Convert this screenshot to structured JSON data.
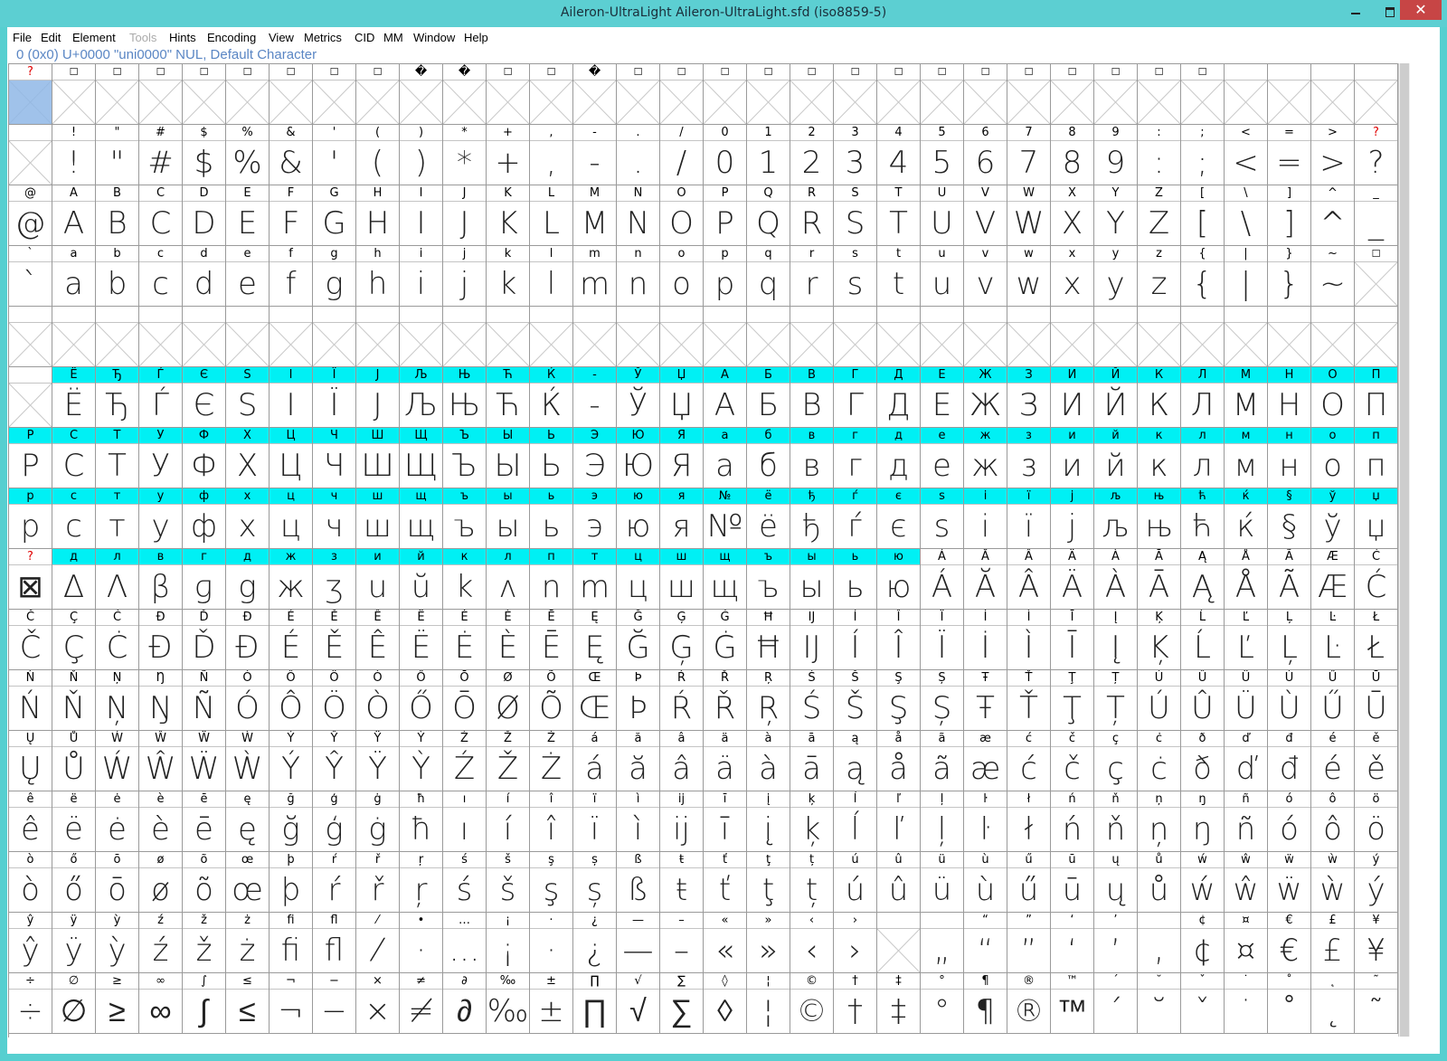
{
  "window": {
    "title": "Aileron-UltraLight  Aileron-UltraLight.sfd (iso8859-5)",
    "close_label": "✕"
  },
  "menu": [
    {
      "label": "File",
      "enabled": true
    },
    {
      "label": "Edit",
      "enabled": true
    },
    {
      "label": "Element",
      "enabled": true
    },
    {
      "label": "Tools",
      "enabled": false
    },
    {
      "label": "Hints",
      "enabled": true
    },
    {
      "label": "Encoding",
      "enabled": true
    },
    {
      "label": "View",
      "enabled": true
    },
    {
      "label": "Metrics",
      "enabled": true
    },
    {
      "label": "CID",
      "enabled": true
    },
    {
      "label": "MM",
      "enabled": true
    },
    {
      "label": "Window",
      "enabled": true
    },
    {
      "label": "Help",
      "enabled": true
    }
  ],
  "status": "0 (0x0) U+0000 \"uni0000\" NUL, Default Character",
  "grid": {
    "columns": 32,
    "rows": [
      {
        "labels": [
          "?",
          "☐",
          "☐",
          "☐",
          "☐",
          "☐",
          "☐",
          "☐",
          "☐",
          "�",
          "�",
          "☐",
          "☐",
          "�",
          "☐",
          "☐",
          "☐",
          "☐",
          "☐",
          "☐",
          "☐",
          "☐",
          "☐",
          "☐",
          "☐",
          "☐",
          "☐",
          "☐",
          "",
          "",
          "",
          ""
        ],
        "glyphs": [
          ""
        ],
        "empty_all": true
      },
      {
        "labels": [
          " ",
          "!",
          "\"",
          "#",
          "$",
          "%",
          "&",
          "'",
          "(",
          ")",
          "*",
          "+",
          ",",
          "-",
          ".",
          "/",
          "0",
          "1",
          "2",
          "3",
          "4",
          "5",
          "6",
          "7",
          "8",
          "9",
          ":",
          ";",
          "<",
          "=",
          ">",
          "?"
        ],
        "glyphs": [
          "",
          "!",
          "\"",
          "#",
          "$",
          "%",
          "&",
          "'",
          "(",
          ")",
          "*",
          "+",
          ",",
          "-",
          ".",
          "/",
          "0",
          "1",
          "2",
          "3",
          "4",
          "5",
          "6",
          "7",
          "8",
          "9",
          ":",
          ";",
          "<",
          "=",
          ">",
          "?"
        ]
      },
      {
        "labels": [
          "@",
          "A",
          "B",
          "C",
          "D",
          "E",
          "F",
          "G",
          "H",
          "I",
          "J",
          "K",
          "L",
          "M",
          "N",
          "O",
          "P",
          "Q",
          "R",
          "S",
          "T",
          "U",
          "V",
          "W",
          "X",
          "Y",
          "Z",
          "[",
          "\\",
          "]",
          "^",
          "_"
        ],
        "glyphs": [
          "@",
          "A",
          "B",
          "C",
          "D",
          "E",
          "F",
          "G",
          "H",
          "I",
          "J",
          "K",
          "L",
          "M",
          "N",
          "O",
          "P",
          "Q",
          "R",
          "S",
          "T",
          "U",
          "V",
          "W",
          "X",
          "Y",
          "Z",
          "[",
          "\\",
          "]",
          "^",
          "_"
        ]
      },
      {
        "labels": [
          "`",
          "a",
          "b",
          "c",
          "d",
          "e",
          "f",
          "g",
          "h",
          "i",
          "j",
          "k",
          "l",
          "m",
          "n",
          "o",
          "p",
          "q",
          "r",
          "s",
          "t",
          "u",
          "v",
          "w",
          "x",
          "y",
          "z",
          "{",
          "|",
          "}",
          "~",
          "☐"
        ],
        "glyphs": [
          "`",
          "a",
          "b",
          "c",
          "d",
          "e",
          "f",
          "g",
          "h",
          "i",
          "j",
          "k",
          "l",
          "m",
          "n",
          "o",
          "p",
          "q",
          "r",
          "s",
          "t",
          "u",
          "v",
          "w",
          "x",
          "y",
          "z",
          "{",
          "|",
          "}",
          "~",
          ""
        ]
      },
      {
        "labels": [
          "",
          "",
          "",
          "",
          "",
          "",
          "",
          "",
          "",
          "",
          "",
          "",
          "",
          "",
          "",
          "",
          "",
          "",
          "",
          "",
          "",
          "",
          "",
          "",
          "",
          "",
          "",
          "",
          "",
          "",
          "",
          ""
        ],
        "glyphs": [
          ""
        ],
        "empty_all": true
      },
      {
        "labels": [
          "",
          "Ё",
          "Ђ",
          "Ѓ",
          "Є",
          "Ѕ",
          "І",
          "Ї",
          "Ј",
          "Љ",
          "Њ",
          "Ћ",
          "Ќ",
          "-",
          "Ў",
          "Џ",
          "А",
          "Б",
          "В",
          "Г",
          "Д",
          "Е",
          "Ж",
          "З",
          "И",
          "Й",
          "К",
          "Л",
          "М",
          "Н",
          "О",
          "П"
        ],
        "glyphs": [
          "",
          "Ё",
          "Ђ",
          "Ѓ",
          "Є",
          "Ѕ",
          "І",
          "Ї",
          "Ј",
          "Љ",
          "Њ",
          "Ћ",
          "Ќ",
          "-",
          "Ў",
          "Џ",
          "А",
          "Б",
          "В",
          "Г",
          "Д",
          "Е",
          "Ж",
          "З",
          "И",
          "Й",
          "К",
          "Л",
          "М",
          "Н",
          "О",
          "П"
        ],
        "cyan_from": 1
      },
      {
        "labels": [
          "Р",
          "С",
          "Т",
          "У",
          "Ф",
          "Х",
          "Ц",
          "Ч",
          "Ш",
          "Щ",
          "Ъ",
          "Ы",
          "Ь",
          "Э",
          "Ю",
          "Я",
          "а",
          "б",
          "в",
          "г",
          "д",
          "е",
          "ж",
          "з",
          "и",
          "й",
          "к",
          "л",
          "м",
          "н",
          "о",
          "п"
        ],
        "glyphs": [
          "Р",
          "С",
          "Т",
          "У",
          "Ф",
          "Х",
          "Ц",
          "Ч",
          "Ш",
          "Щ",
          "Ъ",
          "Ы",
          "Ь",
          "Э",
          "Ю",
          "Я",
          "а",
          "б",
          "в",
          "г",
          "д",
          "е",
          "ж",
          "з",
          "и",
          "й",
          "к",
          "л",
          "м",
          "н",
          "о",
          "п"
        ],
        "cyan_from": 0
      },
      {
        "labels": [
          "р",
          "с",
          "т",
          "у",
          "ф",
          "х",
          "ц",
          "ч",
          "ш",
          "щ",
          "ъ",
          "ы",
          "ь",
          "э",
          "ю",
          "я",
          "№",
          "ё",
          "ђ",
          "ѓ",
          "є",
          "ѕ",
          "і",
          "ї",
          "ј",
          "љ",
          "њ",
          "ћ",
          "ќ",
          "§",
          "ў",
          "џ"
        ],
        "glyphs": [
          "р",
          "с",
          "т",
          "у",
          "ф",
          "х",
          "ц",
          "ч",
          "ш",
          "щ",
          "ъ",
          "ы",
          "ь",
          "э",
          "ю",
          "я",
          "№",
          "ё",
          "ђ",
          "ѓ",
          "є",
          "ѕ",
          "і",
          "ї",
          "ј",
          "љ",
          "њ",
          "ћ",
          "ќ",
          "§",
          "ў",
          "џ"
        ],
        "cyan_from": 0
      },
      {
        "labels": [
          "?",
          "д",
          "л",
          "в",
          "г",
          "д",
          "ж",
          "з",
          "и",
          "й",
          "к",
          "л",
          "п",
          "т",
          "ц",
          "ш",
          "щ",
          "ъ",
          "ы",
          "ь",
          "ю",
          "Á",
          "Ă",
          "Â",
          "Ä",
          "À",
          "Ā",
          "Ą",
          "Å",
          "Ã",
          "Æ",
          "Ć"
        ],
        "glyphs": [
          "⊠",
          "Δ",
          "Λ",
          "β",
          "ɡ",
          "g",
          "ж",
          "ʒ",
          "u",
          "ŭ",
          "k",
          "ʌ",
          "n",
          "m",
          "ц",
          "ш",
          "щ",
          "ъ",
          "ы",
          "ь",
          "ю",
          "Á",
          "Ă",
          "Â",
          "Ä",
          "À",
          "Ā",
          "Ą",
          "Å",
          "Ã",
          "Æ",
          "Ć"
        ],
        "cyan_range": [
          1,
          20
        ]
      },
      {
        "labels": [
          "Č",
          "Ç",
          "Ċ",
          "Ð",
          "Ď",
          "Đ",
          "É",
          "Ě",
          "Ê",
          "Ë",
          "Ė",
          "È",
          "Ē",
          "Ę",
          "Ğ",
          "Ģ",
          "Ġ",
          "Ħ",
          "Ĳ",
          "Í",
          "Î",
          "Ï",
          "İ",
          "Ì",
          "Ī",
          "Į",
          "Ķ",
          "Ĺ",
          "Ľ",
          "Ļ",
          "Ŀ",
          "Ł"
        ],
        "glyphs": [
          "Č",
          "Ç",
          "Ċ",
          "Ð",
          "Ď",
          "Đ",
          "É",
          "Ě",
          "Ê",
          "Ë",
          "Ė",
          "È",
          "Ē",
          "Ę",
          "Ğ",
          "Ģ",
          "Ġ",
          "Ħ",
          "Ĳ",
          "Í",
          "Î",
          "Ï",
          "İ",
          "Ì",
          "Ī",
          "Į",
          "Ķ",
          "Ĺ",
          "Ľ",
          "Ļ",
          "Ŀ",
          "Ł"
        ]
      },
      {
        "labels": [
          "Ń",
          "Ň",
          "Ņ",
          "Ŋ",
          "Ñ",
          "Ó",
          "Ô",
          "Ö",
          "Ò",
          "Ő",
          "Ō",
          "Ø",
          "Õ",
          "Œ",
          "Þ",
          "Ŕ",
          "Ř",
          "Ŗ",
          "Ś",
          "Š",
          "Ş",
          "Ș",
          "Ŧ",
          "Ť",
          "Ţ",
          "Ț",
          "Ú",
          "Û",
          "Ü",
          "Ù",
          "Ű",
          "Ū"
        ],
        "glyphs": [
          "Ń",
          "Ň",
          "Ņ",
          "Ŋ",
          "Ñ",
          "Ó",
          "Ô",
          "Ö",
          "Ò",
          "Ő",
          "Ō",
          "Ø",
          "Õ",
          "Œ",
          "Þ",
          "Ŕ",
          "Ř",
          "Ŗ",
          "Ś",
          "Š",
          "Ş",
          "Ș",
          "Ŧ",
          "Ť",
          "Ţ",
          "Ț",
          "Ú",
          "Û",
          "Ü",
          "Ù",
          "Ű",
          "Ū"
        ]
      },
      {
        "labels": [
          "Ų",
          "Ů",
          "Ẃ",
          "Ŵ",
          "Ẅ",
          "Ẁ",
          "Ý",
          "Ŷ",
          "Ÿ",
          "Ỳ",
          "Ź",
          "Ž",
          "Ż",
          "á",
          "ă",
          "â",
          "ä",
          "à",
          "ā",
          "ą",
          "å",
          "ã",
          "æ",
          "ć",
          "č",
          "ç",
          "ċ",
          "ð",
          "ď",
          "đ",
          "é",
          "ě"
        ],
        "glyphs": [
          "Ų",
          "Ů",
          "Ẃ",
          "Ŵ",
          "Ẅ",
          "Ẁ",
          "Ý",
          "Ŷ",
          "Ÿ",
          "Ỳ",
          "Ź",
          "Ž",
          "Ż",
          "á",
          "ă",
          "â",
          "ä",
          "à",
          "ā",
          "ą",
          "å",
          "ã",
          "æ",
          "ć",
          "č",
          "ç",
          "ċ",
          "ð",
          "ď",
          "đ",
          "é",
          "ě"
        ]
      },
      {
        "labels": [
          "ê",
          "ë",
          "ė",
          "è",
          "ē",
          "ę",
          "ğ",
          "ģ",
          "ġ",
          "ħ",
          "ı",
          "í",
          "î",
          "ï",
          "ì",
          "ĳ",
          "ī",
          "į",
          "ķ",
          "ĺ",
          "ľ",
          "ļ",
          "ŀ",
          "ł",
          "ń",
          "ň",
          "ņ",
          "ŋ",
          "ñ",
          "ó",
          "ô",
          "ö"
        ],
        "glyphs": [
          "ê",
          "ë",
          "ė",
          "è",
          "ē",
          "ę",
          "ğ",
          "ģ",
          "ġ",
          "ħ",
          "ı",
          "í",
          "î",
          "ï",
          "ì",
          "ĳ",
          "ī",
          "į",
          "ķ",
          "ĺ",
          "ľ",
          "ļ",
          "ŀ",
          "ł",
          "ń",
          "ň",
          "ņ",
          "ŋ",
          "ñ",
          "ó",
          "ô",
          "ö"
        ]
      },
      {
        "labels": [
          "ò",
          "ő",
          "ō",
          "ø",
          "õ",
          "œ",
          "þ",
          "ŕ",
          "ř",
          "ŗ",
          "ś",
          "š",
          "ş",
          "ș",
          "ß",
          "ŧ",
          "ť",
          "ţ",
          "ț",
          "ú",
          "û",
          "ü",
          "ù",
          "ű",
          "ū",
          "ų",
          "ů",
          "ẃ",
          "ŵ",
          "ẅ",
          "ẁ",
          "ý"
        ],
        "glyphs": [
          "ò",
          "ő",
          "ō",
          "ø",
          "õ",
          "œ",
          "þ",
          "ŕ",
          "ř",
          "ŗ",
          "ś",
          "š",
          "ş",
          "ș",
          "ß",
          "ŧ",
          "ť",
          "ţ",
          "ț",
          "ú",
          "û",
          "ü",
          "ù",
          "ű",
          "ū",
          "ų",
          "ů",
          "ẃ",
          "ŵ",
          "ẅ",
          "ẁ",
          "ý"
        ]
      },
      {
        "labels": [
          "ŷ",
          "ÿ",
          "ỳ",
          "ź",
          "ž",
          "ż",
          "ﬁ",
          "ﬂ",
          "⁄",
          "•",
          "…",
          "¡",
          "·",
          "¿",
          "—",
          "–",
          "«",
          "»",
          "‹",
          "›",
          "",
          "",
          "“",
          "”",
          "‘",
          "’",
          "",
          "¢",
          "¤",
          "€",
          "£",
          "¥"
        ],
        "glyphs": [
          "ŷ",
          "ÿ",
          "ỳ",
          "ź",
          "ž",
          "ż",
          "ﬁ",
          "ﬂ",
          "⁄",
          "·",
          "…",
          "¡",
          "·",
          "¿",
          "—",
          "–",
          "«",
          "»",
          "‹",
          "›",
          "",
          "„",
          "“",
          "”",
          "‘",
          "’",
          "‚",
          "¢",
          "¤",
          "€",
          "£",
          "¥"
        ]
      },
      {
        "labels": [
          "÷",
          "∅",
          "≥",
          "∞",
          "∫",
          "≤",
          "¬",
          "−",
          "×",
          "≠",
          "∂",
          "‰",
          "±",
          "∏",
          "√",
          "∑",
          "◊",
          "¦",
          "©",
          "†",
          "‡",
          "°",
          "¶",
          "®",
          "™",
          "ˊ",
          "˘",
          "ˇ",
          "˙",
          "˚",
          "˛",
          "˜"
        ],
        "glyphs": [
          "÷",
          "∅",
          "≥",
          "∞",
          "∫",
          "≤",
          "¬",
          "−",
          "×",
          "≠",
          "∂",
          "‰",
          "±",
          "∏",
          "√",
          "∑",
          "◊",
          "¦",
          "©",
          "†",
          "‡",
          "°",
          "¶",
          "®",
          "™",
          "ˊ",
          "˘",
          "ˇ",
          "˙",
          "˚",
          "˛",
          "˜"
        ]
      }
    ]
  },
  "colors": {
    "frame": "#56cfd0",
    "cyan_label": "#00f0f4",
    "selected_cell": "#8fb7e6",
    "status_text": "#5a86c4",
    "missing_mark": "#e00000"
  },
  "icons": [
    "minimize-icon",
    "maximize-icon",
    "close-icon"
  ]
}
